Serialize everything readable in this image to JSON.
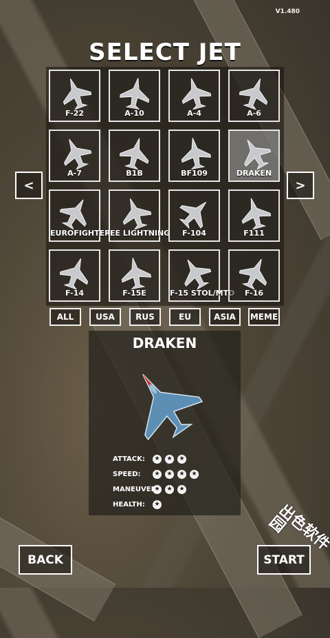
{
  "version": "V1.480",
  "title": "SELECT JET",
  "jets": [
    {
      "name": "F-22"
    },
    {
      "name": "A-10"
    },
    {
      "name": "A-4"
    },
    {
      "name": "A-6"
    },
    {
      "name": "A-7"
    },
    {
      "name": "B1B"
    },
    {
      "name": "BF109"
    },
    {
      "name": "DRAKEN",
      "selected": true
    },
    {
      "name": "EUROFIGHTER"
    },
    {
      "name": "EE LIGHTNING"
    },
    {
      "name": "F-104"
    },
    {
      "name": "F111"
    },
    {
      "name": "F-14"
    },
    {
      "name": "F-15E"
    },
    {
      "name": "F-15 STOL/MTD"
    },
    {
      "name": "F-16"
    }
  ],
  "nav": {
    "prev": "<",
    "next": ">"
  },
  "filters": [
    "ALL",
    "USA",
    "RUS",
    "EU",
    "ASIA",
    "MEME"
  ],
  "detail": {
    "name": "DRAKEN",
    "stats": [
      {
        "label": "ATTACK:",
        "stars": 3
      },
      {
        "label": "SPEED:",
        "stars": 4
      },
      {
        "label": "MANEUVER:",
        "stars": 3
      },
      {
        "label": "HEALTH:",
        "stars": 1
      }
    ]
  },
  "buttons": {
    "back": "BACK",
    "start": "START"
  },
  "watermark": "出色软件园"
}
